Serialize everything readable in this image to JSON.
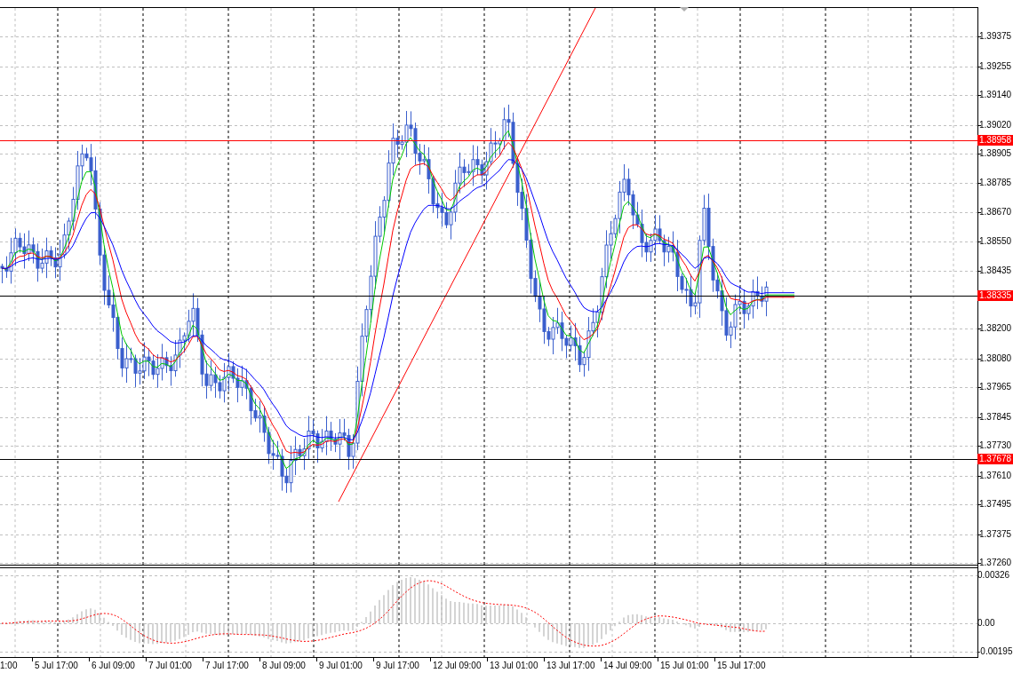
{
  "price_axis": {
    "labels": [
      "1.39375",
      "1.39255",
      "1.39140",
      "1.39020",
      "1.38905",
      "1.38785",
      "1.38670",
      "1.38550",
      "1.38435",
      "1.38200",
      "1.38080",
      "1.37965",
      "1.37845",
      "1.37730",
      "1.37610",
      "1.37495",
      "1.37375",
      "1.37260"
    ]
  },
  "levels": [
    {
      "label": "1.38958",
      "color": "#ff0000"
    },
    {
      "label": "1.38335",
      "color": "#000000"
    },
    {
      "label": "1.37678",
      "color": "#000000"
    }
  ],
  "moving_averages": [
    {
      "color": "#00c800"
    },
    {
      "color": "#ff0000"
    },
    {
      "color": "#0000ff"
    }
  ],
  "indicator_axis": {
    "labels": [
      "0.00326",
      "0.00",
      "-0.00195"
    ]
  },
  "time_axis": {
    "labels": [
      "1:00",
      "5 Jul 17:00",
      "6 Jul 09:00",
      "7 Jul 01:00",
      "7 Jul 17:00",
      "8 Jul 09:00",
      "9 Jul 01:00",
      "9 Jul 17:00",
      "12 Jul 09:00",
      "13 Jul 01:00",
      "13 Jul 17:00",
      "14 Jul 09:00",
      "15 Jul 01:00",
      "15 Jul 17:00"
    ]
  }
}
